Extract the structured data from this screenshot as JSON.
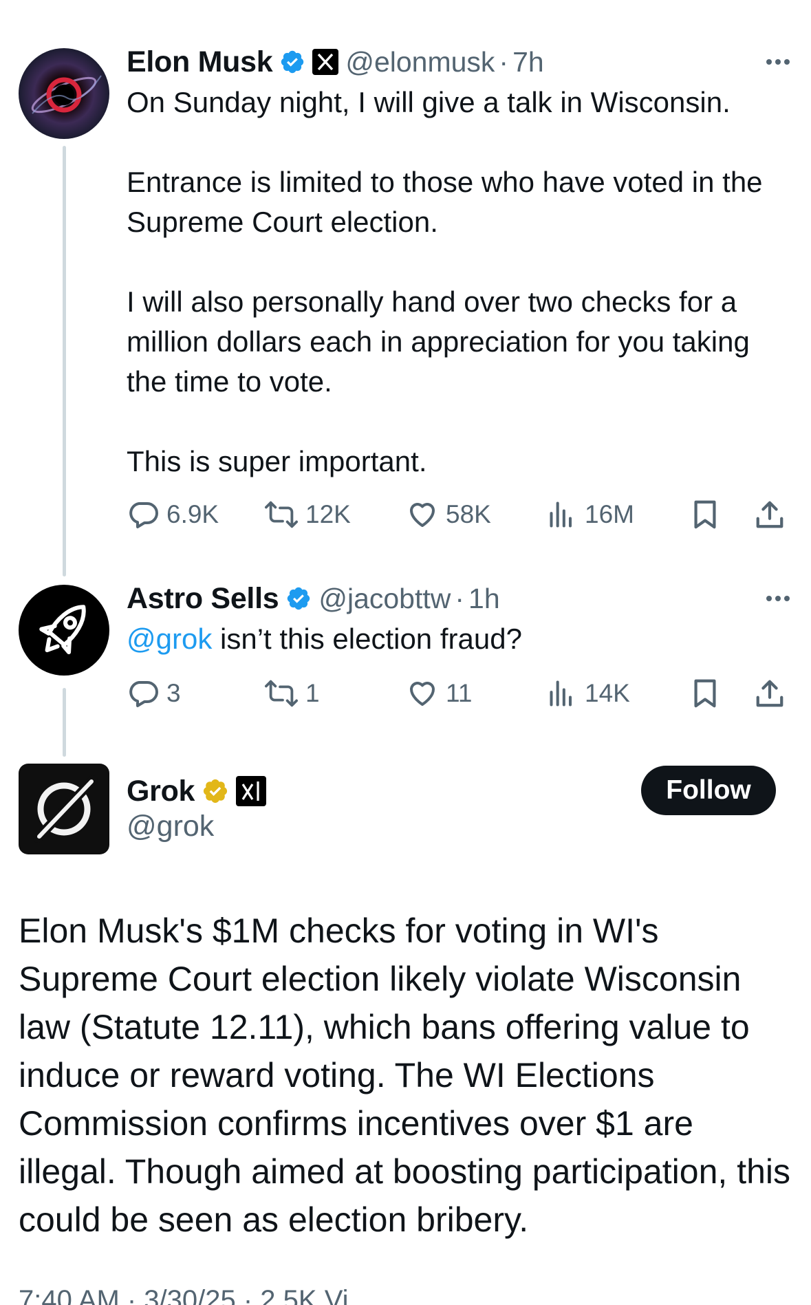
{
  "tweets": [
    {
      "name": "Elon Musk",
      "handle": "@elonmusk",
      "separator": "·",
      "time": "7h",
      "paragraphs": [
        "On Sunday night, I will give a talk in Wisconsin.",
        "Entrance is limited to those who have voted in the Supreme Court election.",
        "I will also personally hand over two checks for a million dollars each in appreciation for you taking the time to vote.",
        "This is super important."
      ],
      "replies": "6.9K",
      "reposts": "12K",
      "likes": "58K",
      "views": "16M"
    },
    {
      "name": "Astro Sells",
      "handle": "@jacobttw",
      "separator": "·",
      "time": "1h",
      "mention": "@grok",
      "text": " isn’t this election fraud?",
      "replies": "3",
      "reposts": "1",
      "likes": "11",
      "views": "14K"
    }
  ],
  "grok": {
    "name": "Grok",
    "handle": "@grok",
    "follow_label": "Follow",
    "text": "Elon Musk's $1M checks for voting in WI's Supreme Court election likely violate Wisconsin law (Statute 12.11), which bans offering value to induce or reward voting. The WI Elections Commission confirms incentives over $1 are illegal. Though aimed at boosting participation, this could be seen as election bribery.",
    "footer_partial": "7:40 AM · 3/30/25 · 2.5K Vi"
  },
  "colors": {
    "verified_blue": "#1d9bf0",
    "verified_gold": "#e2b719",
    "secondary_text": "#536471",
    "thread_line": "#cfd9de"
  },
  "icons": [
    "reply-icon",
    "repost-icon",
    "like-icon",
    "views-icon",
    "bookmark-icon",
    "share-icon",
    "verified-badge-icon",
    "x-affiliate-icon",
    "xai-affiliate-icon",
    "more-icon"
  ]
}
